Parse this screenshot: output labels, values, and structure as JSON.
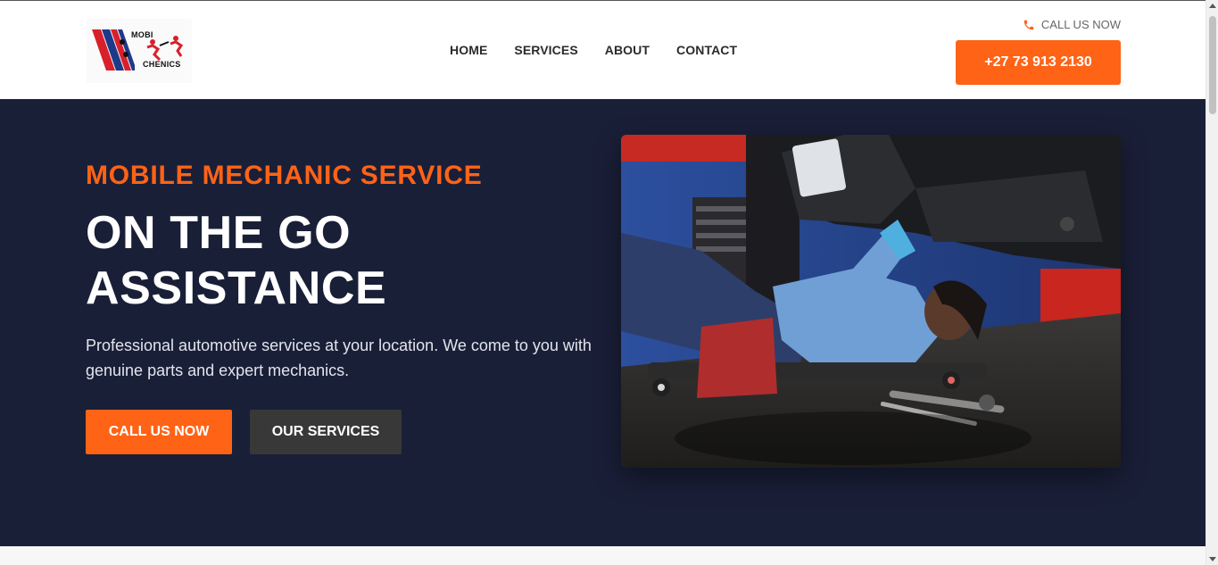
{
  "brand": {
    "logo_top": "MOBI",
    "logo_bottom": "CHENICS",
    "accent_color": "#ff6316",
    "hero_bg_color": "#1a1f38"
  },
  "nav": {
    "items": [
      {
        "label": "HOME"
      },
      {
        "label": "SERVICES"
      },
      {
        "label": "ABOUT"
      },
      {
        "label": "CONTACT"
      }
    ]
  },
  "header": {
    "call_label": "CALL US NOW",
    "call_icon": "phone-icon",
    "phone_button": "+27 73 913 2130"
  },
  "hero": {
    "eyebrow": "MOBILE MECHANIC SERVICE",
    "headline": "ON THE GO ASSISTANCE",
    "description": "Professional automotive services at your location. We come to you with genuine parts and expert mechanics.",
    "primary_button": "CALL US NOW",
    "secondary_button": "OUR SERVICES",
    "image": "mechanic-under-car-photo"
  }
}
